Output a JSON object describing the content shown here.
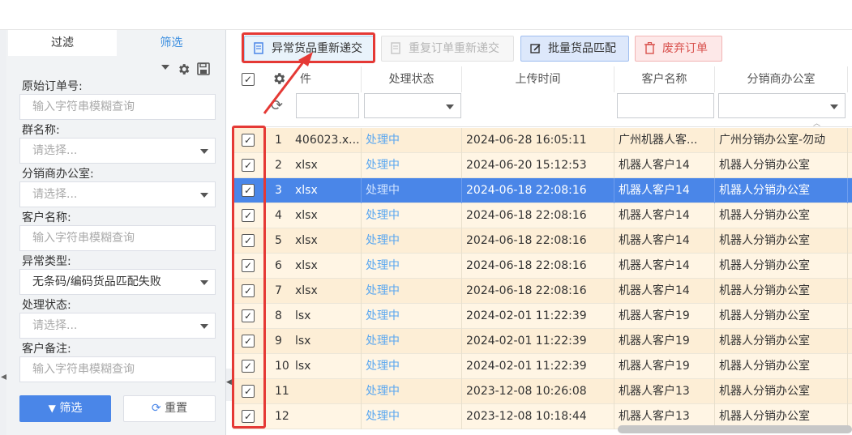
{
  "sidebar": {
    "tabs": [
      "过滤",
      "筛选"
    ],
    "fields": [
      {
        "label": "原始订单号:",
        "value": "",
        "placeholder": "输入字符串模糊查询",
        "type": "text"
      },
      {
        "label": "群名称:",
        "value": "",
        "placeholder": "请选择...",
        "type": "select"
      },
      {
        "label": "分销商办公室:",
        "value": "",
        "placeholder": "请选择...",
        "type": "select"
      },
      {
        "label": "客户名称:",
        "value": "",
        "placeholder": "输入字符串模糊查询",
        "type": "text"
      },
      {
        "label": "异常类型:",
        "value": "无条码/编码货品匹配失败",
        "placeholder": "",
        "type": "select"
      },
      {
        "label": "处理状态:",
        "value": "",
        "placeholder": "请选择...",
        "type": "select"
      },
      {
        "label": "客户备注:",
        "value": "",
        "placeholder": "输入字符串模糊查询",
        "type": "text"
      }
    ],
    "filter_button": "筛选",
    "reset_button": "重置"
  },
  "toolbar": {
    "resubmit_abnormal": "异常货品重新递交",
    "resubmit_duplicate": "重复订单重新递交",
    "batch_match": "批量货品匹配",
    "discard_order": "废弃订单"
  },
  "table": {
    "columns": [
      "件",
      "处理状态",
      "上传时间",
      "客户名称",
      "分销商办公室"
    ],
    "rows": [
      {
        "no": "1",
        "file": "406023.x...",
        "status": "处理中",
        "time": "2024-06-28 16:05:11",
        "customer": "广州机器人客...",
        "office": "广州分销办公室-勿动",
        "checked": true,
        "selected": false
      },
      {
        "no": "2",
        "file": "xlsx",
        "status": "处理中",
        "time": "2024-06-20 15:12:53",
        "customer": "机器人客户14",
        "office": "机器人分销办公室",
        "checked": true,
        "selected": false
      },
      {
        "no": "3",
        "file": "xlsx",
        "status": "处理中",
        "time": "2024-06-18 22:08:16",
        "customer": "机器人客户14",
        "office": "机器人分销办公室",
        "checked": true,
        "selected": true
      },
      {
        "no": "4",
        "file": "xlsx",
        "status": "处理中",
        "time": "2024-06-18 22:08:16",
        "customer": "机器人客户14",
        "office": "机器人分销办公室",
        "checked": true,
        "selected": false
      },
      {
        "no": "5",
        "file": "xlsx",
        "status": "处理中",
        "time": "2024-06-18 22:08:16",
        "customer": "机器人客户14",
        "office": "机器人分销办公室",
        "checked": true,
        "selected": false
      },
      {
        "no": "6",
        "file": "xlsx",
        "status": "处理中",
        "time": "2024-06-18 22:08:16",
        "customer": "机器人客户14",
        "office": "机器人分销办公室",
        "checked": true,
        "selected": false
      },
      {
        "no": "7",
        "file": "xlsx",
        "status": "处理中",
        "time": "2024-06-18 22:08:16",
        "customer": "机器人客户14",
        "office": "机器人分销办公室",
        "checked": true,
        "selected": false
      },
      {
        "no": "8",
        "file": "lsx",
        "status": "处理中",
        "time": "2024-02-01 11:22:39",
        "customer": "机器人客户19",
        "office": "机器人分销办公室",
        "checked": true,
        "selected": false
      },
      {
        "no": "9",
        "file": "lsx",
        "status": "处理中",
        "time": "2024-02-01 11:22:39",
        "customer": "机器人客户19",
        "office": "机器人分销办公室",
        "checked": true,
        "selected": false
      },
      {
        "no": "10",
        "file": "lsx",
        "status": "处理中",
        "time": "2024-02-01 11:22:39",
        "customer": "机器人客户19",
        "office": "机器人分销办公室",
        "checked": true,
        "selected": false
      },
      {
        "no": "11",
        "file": "",
        "status": "处理中",
        "time": "2023-12-08 10:26:08",
        "customer": "机器人客户13",
        "office": "机器人分销办公室",
        "checked": true,
        "selected": false
      },
      {
        "no": "12",
        "file": "",
        "status": "处理中",
        "time": "2023-12-08 10:18:44",
        "customer": "机器人客户13",
        "office": "机器人分销办公室",
        "checked": true,
        "selected": false
      }
    ]
  },
  "colors": {
    "accent": "#4a86e8",
    "highlight_box": "#e53935",
    "status_text": "#5aa7f0",
    "row_bg": "#fdeed6"
  }
}
